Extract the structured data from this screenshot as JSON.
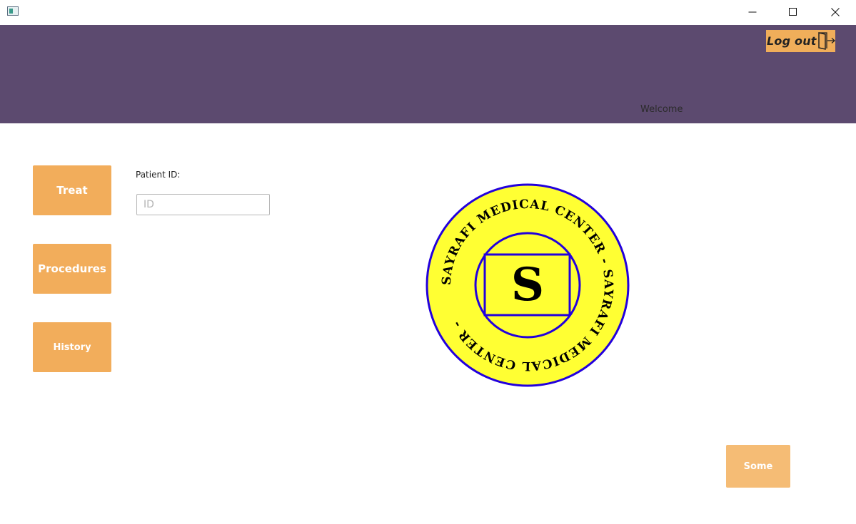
{
  "window": {
    "app_icon": "application-icon",
    "controls": [
      "minimize-icon",
      "maximize-icon",
      "close-icon"
    ]
  },
  "header": {
    "logout_label": "Log out",
    "logout_icon": "exit-door-icon",
    "welcome_text": "Welcome"
  },
  "sidebar": {
    "items": [
      {
        "label": "Treat"
      },
      {
        "label": "Procedures"
      },
      {
        "label": "History"
      }
    ]
  },
  "patient": {
    "label": "Patient ID:",
    "placeholder": "ID",
    "value": ""
  },
  "logo": {
    "ring_text": "SAYRAFI MEDICAL CENTER - SAYRAFI MEDICAL CENTER -",
    "monogram": "S"
  },
  "footer": {
    "some_label": "Some"
  },
  "colors": {
    "header_bg": "#5c4a6f",
    "button_orange": "#f2ad5b",
    "logo_yellow": "#ffff33",
    "logo_blue": "#2200dd"
  }
}
